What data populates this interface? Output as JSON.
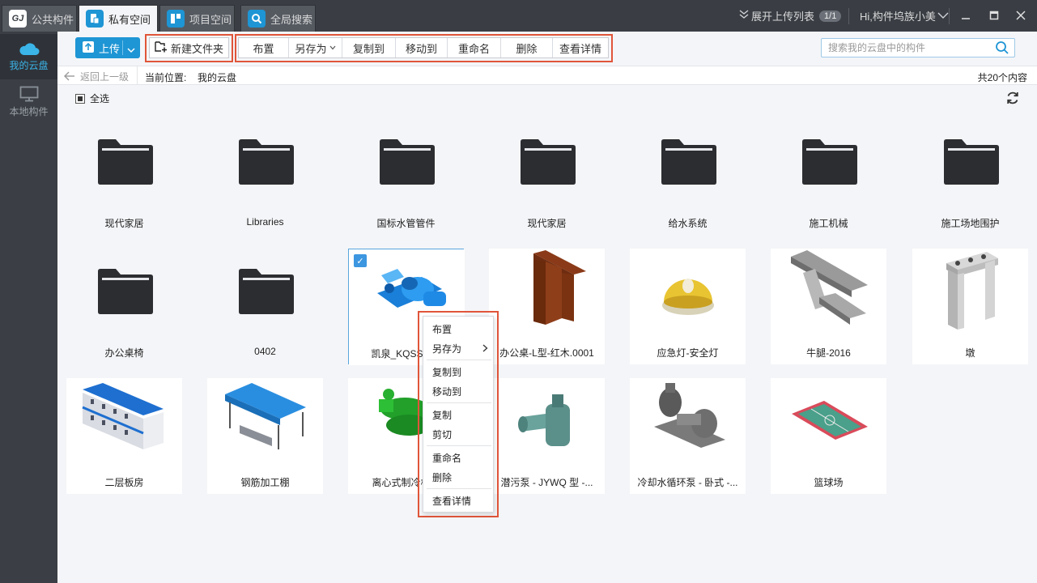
{
  "titlebar": {
    "tabs": [
      {
        "label": "公共构件",
        "icon": "gj-logo-icon",
        "icon_text": "GJ"
      },
      {
        "label": "私有空间",
        "icon": "private-space-icon"
      },
      {
        "label": "项目空间",
        "icon": "project-space-icon"
      },
      {
        "label": "全局搜索",
        "icon": "search-icon"
      }
    ],
    "upload_list_label": "展开上传列表",
    "upload_list_count": "1/1",
    "user_greeting": "Hi,构件坞族小美"
  },
  "sidebar": {
    "items": [
      {
        "label": "我的云盘",
        "icon": "cloud-icon"
      },
      {
        "label": "本地构件",
        "icon": "monitor-icon"
      }
    ]
  },
  "toolbar": {
    "upload_label": "上传",
    "new_folder_label": "新建文件夹",
    "actions": [
      "布置",
      "另存为",
      "复制到",
      "移动到",
      "重命名",
      "删除",
      "查看详情"
    ],
    "search_placeholder": "搜索我的云盘中的构件"
  },
  "pathbar": {
    "back_label": "返回上一级",
    "location_label": "当前位置:",
    "location_value": "我的云盘",
    "item_count": "共20个内容"
  },
  "select_all_label": "全选",
  "items": [
    {
      "name": "现代家居",
      "type": "folder"
    },
    {
      "name": "Libraries",
      "type": "folder"
    },
    {
      "name": "国标水管管件",
      "type": "folder"
    },
    {
      "name": "现代家居",
      "type": "folder"
    },
    {
      "name": "给水系统",
      "type": "folder"
    },
    {
      "name": "施工机械",
      "type": "folder"
    },
    {
      "name": "施工场地围护",
      "type": "folder"
    },
    {
      "name": "办公桌椅",
      "type": "folder"
    },
    {
      "name": "0402",
      "type": "folder"
    },
    {
      "name": "凯泉_KQSS系列",
      "type": "model",
      "selected": true
    },
    {
      "name": "办公桌-L型-红木.0001",
      "type": "model"
    },
    {
      "name": "应急灯-安全灯",
      "type": "model"
    },
    {
      "name": "牛腿-2016",
      "type": "model"
    },
    {
      "name": "墩",
      "type": "model"
    },
    {
      "name": "二层板房",
      "type": "model"
    },
    {
      "name": "钢筋加工棚",
      "type": "model"
    },
    {
      "name": "离心式制冷机组",
      "type": "model"
    },
    {
      "name": "潜污泵 - JYWQ 型 -...",
      "type": "model"
    },
    {
      "name": "冷却水循环泵 - 卧式 -...",
      "type": "model"
    },
    {
      "name": "篮球场",
      "type": "model"
    }
  ],
  "context_menu": {
    "items": [
      "布置",
      "另存为",
      "复制到",
      "移动到",
      "复制",
      "剪切",
      "重命名",
      "删除",
      "查看详情"
    ]
  },
  "colors": {
    "accent": "#1e95d4",
    "highlight_box": "#e0553a",
    "background": "#f4f5f8",
    "chrome": "#3b3f45"
  }
}
